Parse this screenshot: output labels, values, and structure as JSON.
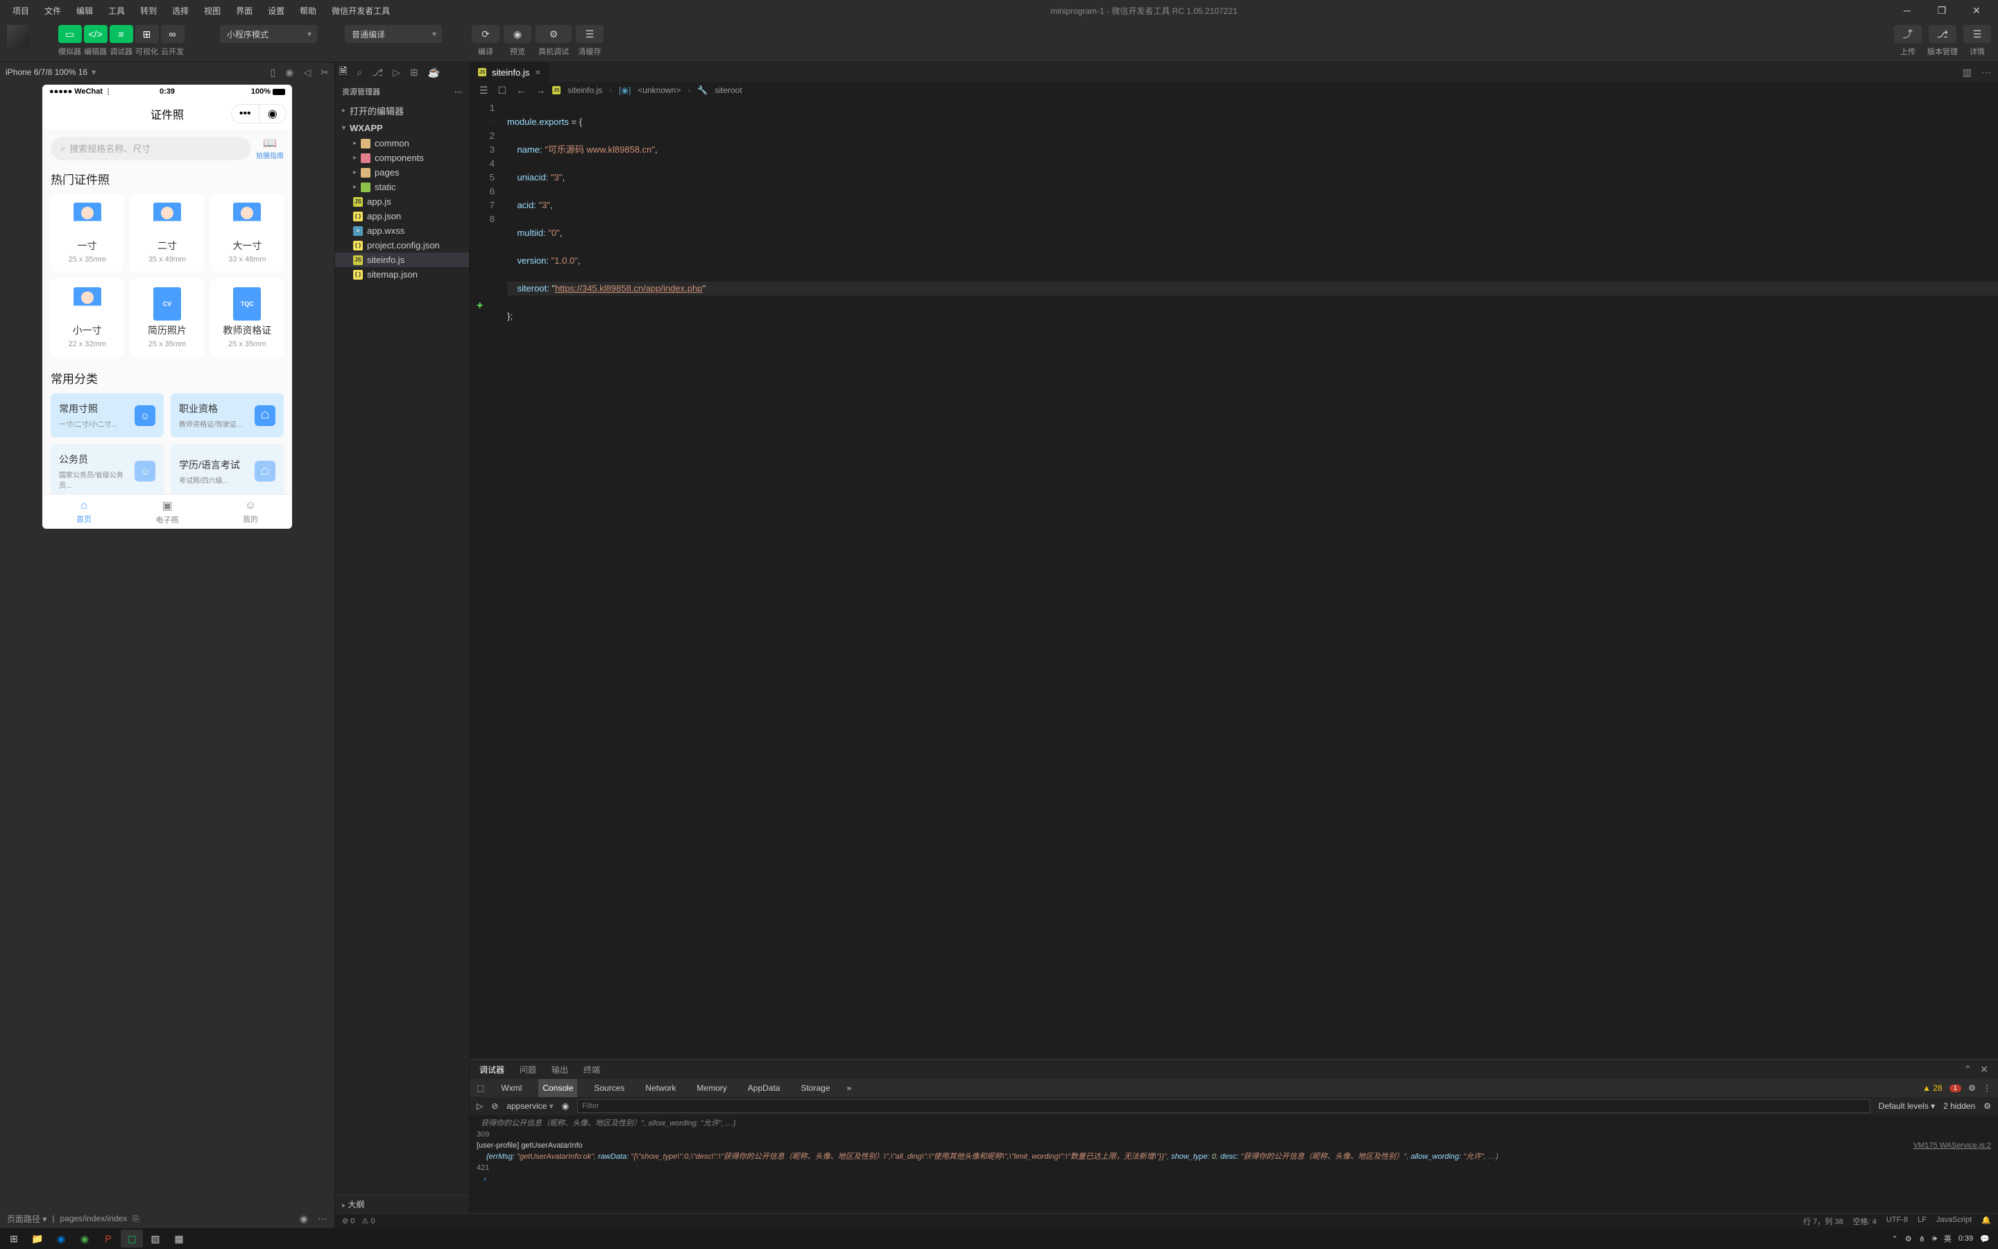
{
  "menubar": [
    "项目",
    "文件",
    "编辑",
    "工具",
    "转到",
    "选择",
    "视图",
    "界面",
    "设置",
    "帮助",
    "微信开发者工具"
  ],
  "window_title": "miniprogram-1 - 微信开发者工具 RC 1.05.2107221",
  "toolbar": {
    "labels1": [
      "模拟器",
      "编辑器",
      "调试器",
      "可视化",
      "云开发"
    ],
    "mode_select": "小程序模式",
    "compile_select": "普通编译",
    "compile_labels": [
      "编译",
      "预览",
      "真机调试",
      "清缓存"
    ],
    "right_labels": [
      "上传",
      "版本管理",
      "详情"
    ]
  },
  "simulator": {
    "device": "iPhone 6/7/8 100% 16",
    "status_left": "●●●●● WeChat",
    "status_time": "0:39",
    "status_batt": "100%",
    "nav_title": "证件照",
    "search_placeholder": "搜索规格名称、尺寸",
    "shoot_guide": "拍摄指南",
    "section1": "热门证件照",
    "cards": [
      {
        "label": "一寸",
        "dim": "25 x 35mm",
        "type": "p"
      },
      {
        "label": "二寸",
        "dim": "35 x 49mm",
        "type": "p"
      },
      {
        "label": "大一寸",
        "dim": "33 x 48mm",
        "type": "p"
      },
      {
        "label": "小一寸",
        "dim": "22 x 32mm",
        "type": "p"
      },
      {
        "label": "简历照片",
        "dim": "25 x 35mm",
        "type": "cv",
        "badge": "CV"
      },
      {
        "label": "教师资格证",
        "dim": "25 x 35mm",
        "type": "tqc",
        "badge": "TQC"
      }
    ],
    "section2": "常用分类",
    "categories": [
      {
        "title": "常用寸照",
        "desc": "一寸/二寸/小二寸..."
      },
      {
        "title": "职业资格",
        "desc": "教师资格证/驾驶证..."
      },
      {
        "title": "公务员",
        "desc": "国家公务员/省级公务员..."
      },
      {
        "title": "学历/语言考试",
        "desc": "考试照/四六级..."
      }
    ],
    "tabs": [
      {
        "label": "首页",
        "icon": "⌂",
        "active": true
      },
      {
        "label": "电子照",
        "icon": "▣",
        "active": false
      },
      {
        "label": "我的",
        "icon": "☺",
        "active": false
      }
    ],
    "page_path": "页面路径 ▾",
    "page_path_val": "pages/index/index"
  },
  "explorer": {
    "title": "资源管理器",
    "section_open": "打开的编辑器",
    "root": "WXAPP",
    "folders": [
      "common",
      "components",
      "pages",
      "static"
    ],
    "files": [
      "app.js",
      "app.json",
      "app.wxss",
      "project.config.json",
      "siteinfo.js",
      "sitemap.json"
    ],
    "active_file": "siteinfo.js",
    "outline": "大纲"
  },
  "editor": {
    "tab": "siteinfo.js",
    "breadcrumb": [
      "siteinfo.js",
      "<unknown>",
      "siteroot"
    ],
    "lines": {
      "1": "module.exports = {",
      "2_prop": "name:",
      "2_val": "\"可乐源码 www.kl89858.cn\"",
      "3_prop": "uniacid:",
      "3_val": "\"3\"",
      "4_prop": "acid:",
      "4_val": "\"3\"",
      "5_prop": "multiid:",
      "5_val": "\"0\"",
      "6_prop": "version:",
      "6_val": "\"1.0.0\"",
      "7_prop": "siteroot:",
      "7_val": "\"https://345.kl89858.cn/app/index.php\"",
      "8": "};"
    }
  },
  "debugger": {
    "tabs": [
      "调试器",
      "问题",
      "输出",
      "终端"
    ],
    "devtools": [
      "Wxml",
      "Console",
      "Sources",
      "Network",
      "Memory",
      "AppData",
      "Storage"
    ],
    "warn_count": "28",
    "err_count": "1",
    "context": "appservice",
    "filter_ph": "Filter",
    "levels": "Default levels ▾",
    "hidden": "2 hidden",
    "log1_ln": "309",
    "log2_src": "VM175 WAService.js:2",
    "log2_tag": "[user-profile] getUserAvatarInfo",
    "log2_body": "{errMsg: \"getUserAvatarInfo:ok\", rawData: \"{\\\"show_type\\\":0,\\\"desc\\\":\\\"获得你的公开信息（昵称、头像、地区及性别）\\\",\\\"all_ding\\\":\\\"使用其他头像和昵称\\\",\\\"limit_wording\\\":\\\"数量已达上限，无法新增\\\"}}\", show_type: 0, desc: \"获得你的公开信息（昵称、头像、地区及性别）\", allow_wording: \"允许\", …}",
    "log3_ln": "421"
  },
  "mid_status": {
    "err": "0",
    "warn": "0"
  },
  "statusbar": {
    "pos": "行 7，列 38",
    "spaces": "空格: 4",
    "enc": "UTF-8",
    "eol": "LF",
    "lang": "JavaScript"
  },
  "taskbar": {
    "time": "0:39",
    "ime": "英"
  }
}
